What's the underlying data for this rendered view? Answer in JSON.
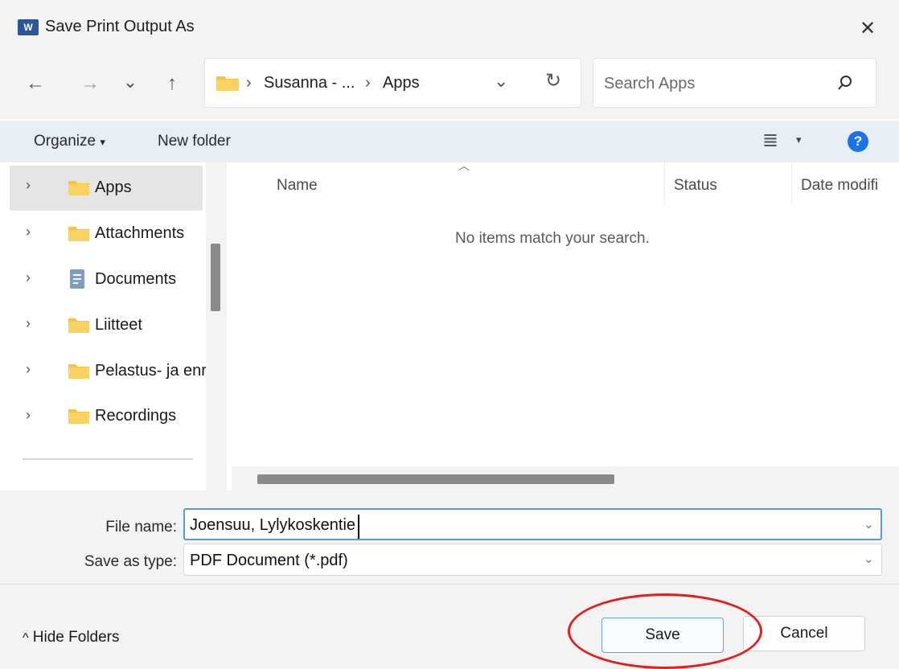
{
  "window": {
    "title": "Save Print Output As",
    "app_icon_letter": "W",
    "close_glyph": "✕"
  },
  "nav": {
    "back_glyph": "←",
    "forward_glyph": "→",
    "recent_glyph": "⌄",
    "up_glyph": "↑",
    "breadcrumb": [
      "Susanna - ...",
      "Apps"
    ],
    "crumb_separator": "›",
    "dropdown_glyph": "⌄",
    "refresh_glyph": "↻",
    "search_placeholder": "Search Apps"
  },
  "command_bar": {
    "organize_label": "Organize",
    "organize_caret": "▾",
    "new_folder_label": "New folder",
    "view_glyph": "≣",
    "view_caret": "▾",
    "help_glyph": "?"
  },
  "tree": {
    "items": [
      {
        "label": "Apps",
        "icon": "folder-icon",
        "selected": true
      },
      {
        "label": "Attachments",
        "icon": "folder-icon",
        "selected": false
      },
      {
        "label": "Documents",
        "icon": "documents-icon",
        "selected": false
      },
      {
        "label": "Liitteet",
        "icon": "folder-icon",
        "selected": false
      },
      {
        "label": "Pelastus- ja enr",
        "icon": "folder-icon",
        "selected": false
      },
      {
        "label": "Recordings",
        "icon": "folder-icon",
        "selected": false
      }
    ],
    "chevron_glyph": "›"
  },
  "file_list": {
    "sort_glyph": "︿",
    "columns": [
      "Name",
      "Status",
      "Date modifi"
    ],
    "empty_message": "No items match your search."
  },
  "form": {
    "file_name_label": "File name:",
    "file_name_value": "Joensuu, Lylykoskentie",
    "save_as_type_label": "Save as type:",
    "save_as_type_value": "PDF Document (*.pdf)",
    "dropdown_glyph": "⌄"
  },
  "footer": {
    "hide_folders_glyph": "^",
    "hide_folders_label": "Hide Folders",
    "save_label": "Save",
    "cancel_label": "Cancel"
  },
  "colors": {
    "accent": "#1a73e8",
    "folder": "#f6c343",
    "annotation": "#e02020"
  }
}
